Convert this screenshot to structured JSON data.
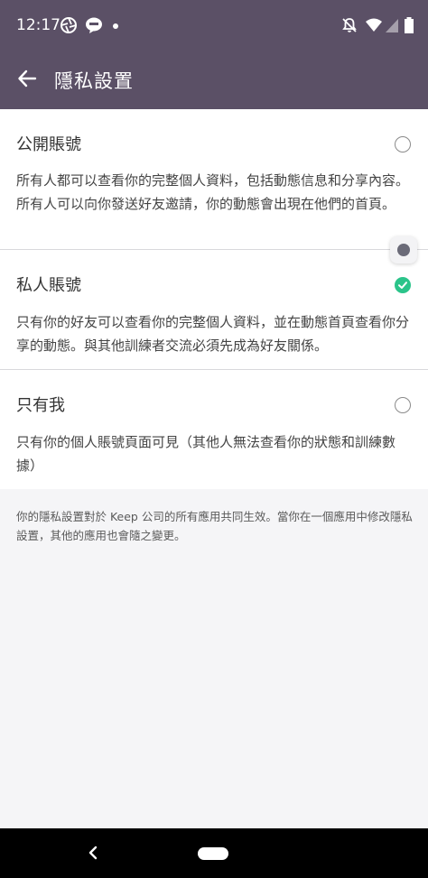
{
  "status_bar": {
    "time": "12:17"
  },
  "toolbar": {
    "title": "隱私設置",
    "back_icon": "arrow-left-icon"
  },
  "options": [
    {
      "title": "公開賬號",
      "description": "所有人都可以查看你的完整個人資料，包括動態信息和分享內容。所有人可以向你發送好友邀請，你的動態會出現在他們的首頁。",
      "selected": false
    },
    {
      "title": "私人賬號",
      "description": "只有你的好友可以查看你的完整個人資料，並在動態首頁查看你分享的動態。與其他訓練者交流必須先成為好友關係。",
      "selected": true
    },
    {
      "title": "只有我",
      "description": "只有你的個人賬號頁面可見（其他人無法查看你的狀態和訓練數據）",
      "selected": false
    }
  ],
  "footer_note": "你的隱私設置對於 Keep 公司的所有應用共同生效。當你在一個應用中修改隱私設置，其他的應用也會隨之變更。",
  "colors": {
    "header": "#5b5066",
    "accent": "#2bc48a",
    "background": "#f5f5f7"
  }
}
